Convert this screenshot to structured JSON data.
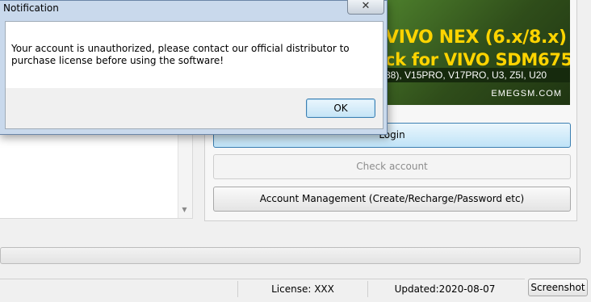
{
  "dialog": {
    "title": "Notification",
    "close_glyph": "✕",
    "message": "Your account is unauthorized, please contact our official distributor to purchase license before using the software!",
    "ok_label": "OK"
  },
  "banner": {
    "line1": "VIVO NEX (6.x/8.x)",
    "line2": "ck for VIVO SDM675",
    "models": "38), V15PRO, V17PRO, U3, Z5I, U20",
    "brand": "EMEGSM.COM"
  },
  "buttons": {
    "login": "Login",
    "check_account": "Check account",
    "account_management": "Account Management (Create/Recharge/Password etc)",
    "screenshot": "Screenshot"
  },
  "status": {
    "license": "License: XXX",
    "updated": "Updated:2020-08-07"
  },
  "icons": {
    "scroll_down": "chevron-down-icon",
    "close": "close-icon"
  },
  "colors": {
    "banner_text": "#ffd400",
    "dialog_frame": "#c9d9ec",
    "accent_border": "#3c7fb1"
  }
}
